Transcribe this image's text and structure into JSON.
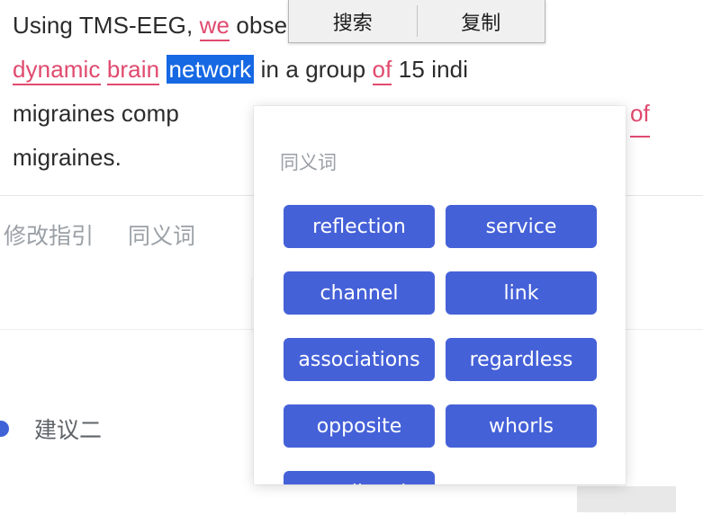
{
  "document": {
    "lines": [
      {
        "id": "line-1",
        "tokens": [
          {
            "text": "Using TMS-EEG, ",
            "style": "plain"
          },
          {
            "text": "we",
            "style": "suggestion"
          },
          {
            "text": " observed alterations in",
            "style": "plain"
          }
        ]
      },
      {
        "id": "line-2",
        "tokens": [
          {
            "text": "dynamic",
            "style": "suggestion"
          },
          {
            "text": " ",
            "style": "plain"
          },
          {
            "text": "brain",
            "style": "suggestion"
          },
          {
            "text": " ",
            "style": "plain"
          },
          {
            "text": "network",
            "style": "selected"
          },
          {
            "text": " in a group ",
            "style": "plain"
          },
          {
            "text": "of",
            "style": "suggestion"
          },
          {
            "text": " 15 indi",
            "style": "plain"
          }
        ]
      },
      {
        "id": "line-3",
        "tokens": [
          {
            "text": "migraines comp",
            "style": "plain"
          }
        ],
        "right_fragment": "of"
      },
      {
        "id": "line-4",
        "tokens": [
          {
            "text": "migraines.",
            "style": "plain"
          }
        ]
      }
    ],
    "selected_word": "network"
  },
  "context_menu": {
    "items": [
      {
        "label": "搜索",
        "name": "search"
      },
      {
        "label": "复制",
        "name": "copy"
      }
    ]
  },
  "tabs": [
    {
      "label": "修改指引",
      "name": "revision-guide"
    },
    {
      "label": "同义词",
      "name": "synonyms"
    }
  ],
  "suggestion": {
    "bullet_icon": "dot-icon",
    "label": "建议二"
  },
  "synonyms_popup": {
    "title": "同义词",
    "items": [
      "reflection",
      "service",
      "channel",
      "link",
      "associations",
      "regardless",
      "opposite",
      "whorls",
      "predicted"
    ]
  },
  "colors": {
    "chip_blue": "#4561d8",
    "selection_blue": "#1668e3",
    "suggestion_pink": "#e04a6e",
    "tab_gray": "#9aa0a6",
    "menu_bg": "#f0f0f0"
  }
}
